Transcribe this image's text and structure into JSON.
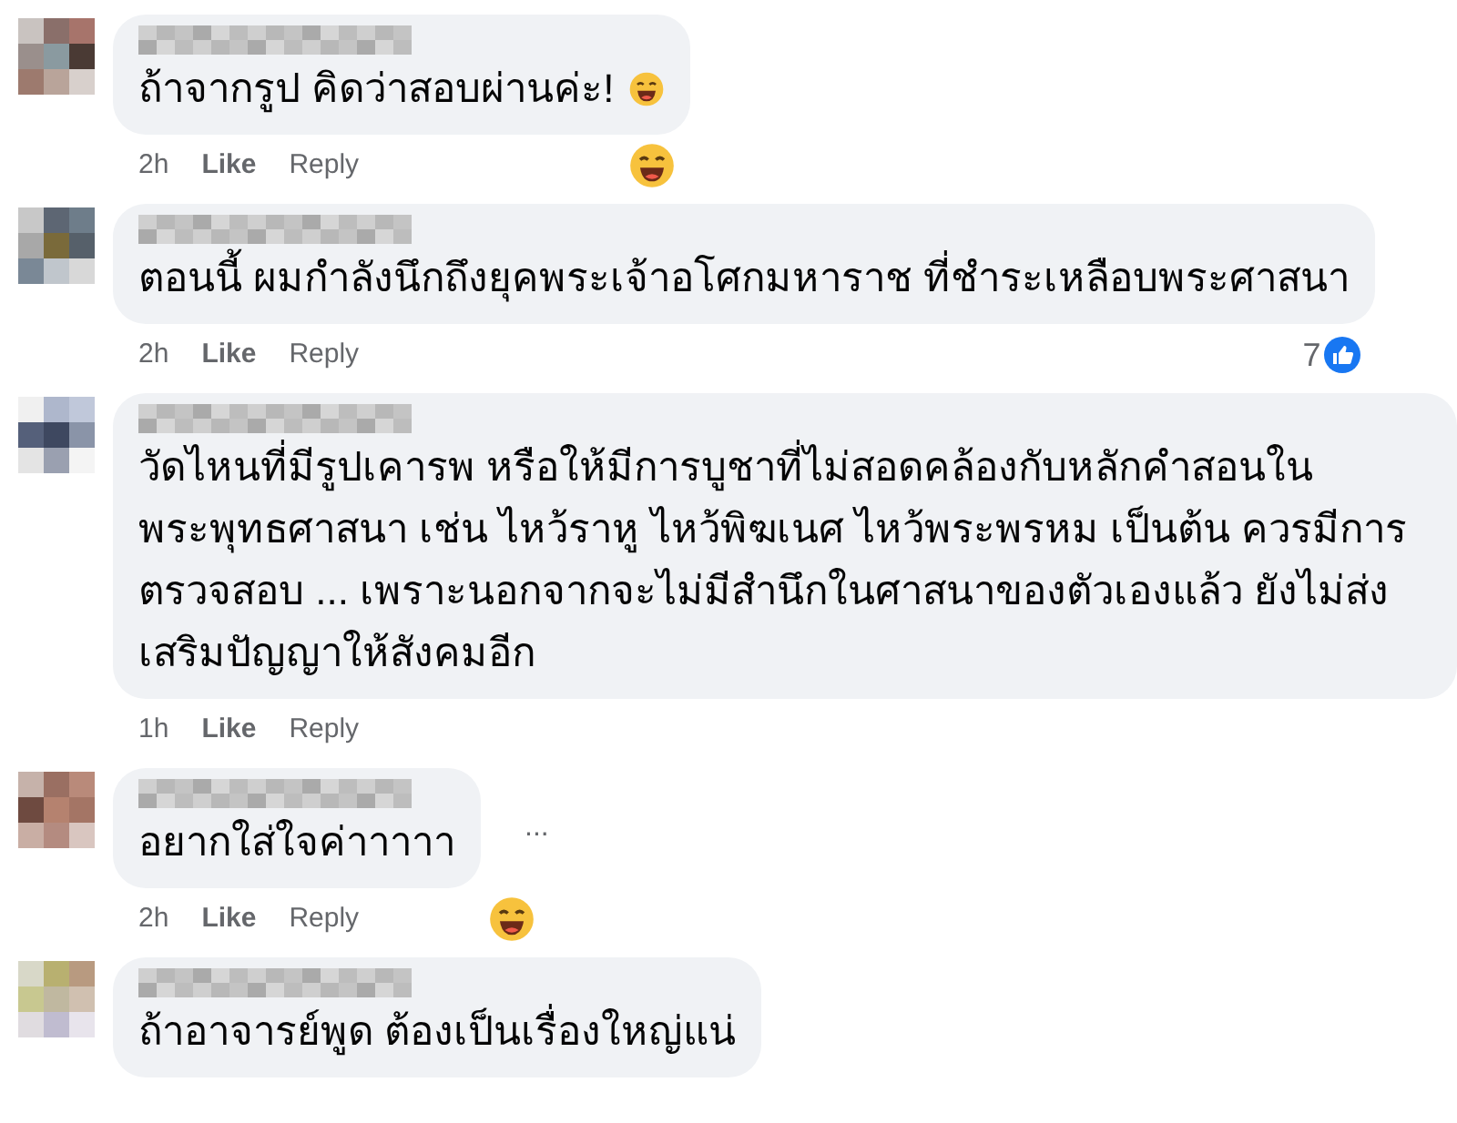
{
  "comments": [
    {
      "text": "ถ้าจากรูป คิดว่าสอบผ่านค่ะ!",
      "inline_emoji": true,
      "time": "2h",
      "like": "Like",
      "reply": "Reply",
      "reaction": true
    },
    {
      "text": "ตอนนี้ ผมกำลังนึกถึงยุคพระเจ้าอโศกมหาราช ที่ชำระเหลือบพระศาสนา",
      "inline_emoji": false,
      "time": "2h",
      "like": "Like",
      "reply": "Reply",
      "reaction": false,
      "like_count": "7"
    },
    {
      "text": "วัดไหนที่มีรูปเคารพ หรือให้มีการบูชาที่ไม่สอดคล้องกับหลักคำสอนใน พระพุทธศาสนา เช่น ไหว้ราหู ไหว้พิฆเนศ ไหว้พระพรหม เป็นต้น ควรมีการ ตรวจสอบ ... เพราะนอกจากจะไม่มีสำนึกในศาสนาของตัวเองแล้ว ยังไม่ส่ง เสริมปัญญาให้สังคมอีก",
      "inline_emoji": false,
      "time": "1h",
      "like": "Like",
      "reply": "Reply",
      "reaction": false
    },
    {
      "text": "อยากใส่ใจค่าาาาา",
      "inline_emoji": false,
      "time": "2h",
      "like": "Like",
      "reply": "Reply",
      "reaction": true,
      "more": "..."
    },
    {
      "text": "ถ้าอาจารย์พูด ต้องเป็นเรื่องใหญ่แน่",
      "inline_emoji": false,
      "reaction": false
    }
  ]
}
